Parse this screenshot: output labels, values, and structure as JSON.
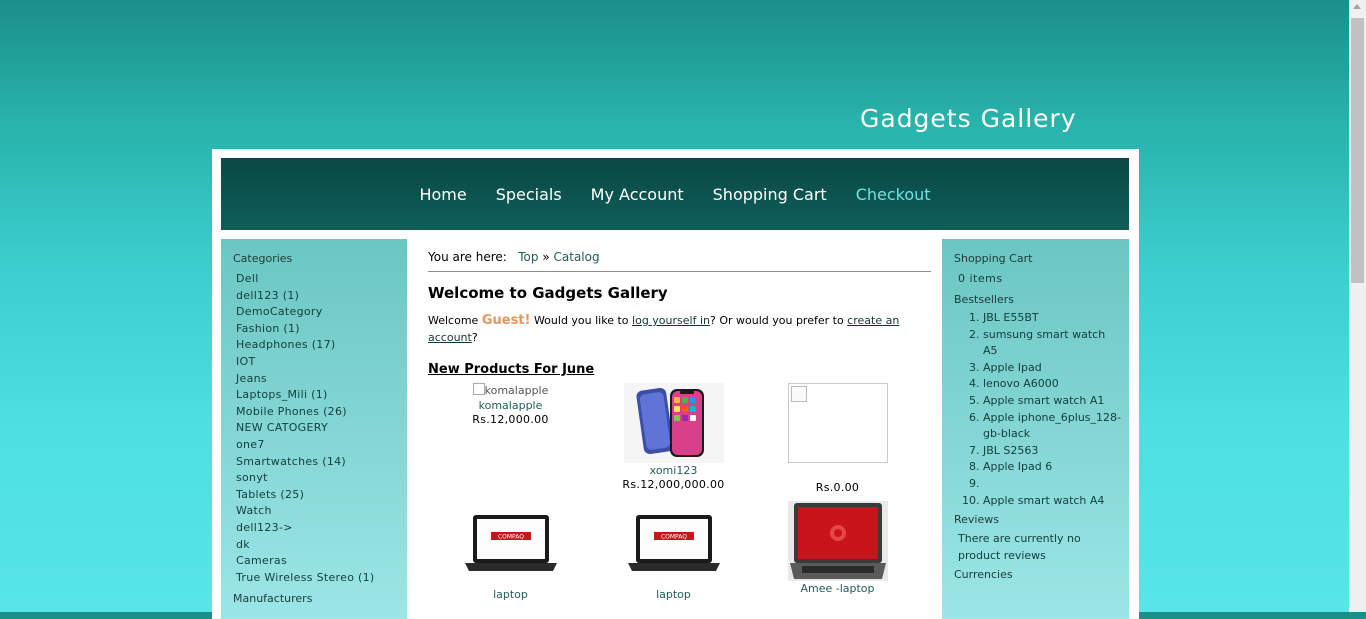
{
  "site": {
    "title": "Gadgets Gallery"
  },
  "nav": {
    "items": [
      {
        "label": "Home"
      },
      {
        "label": "Specials"
      },
      {
        "label": "My Account"
      },
      {
        "label": "Shopping Cart"
      },
      {
        "label": "Checkout"
      }
    ]
  },
  "left": {
    "categories_title": "Categories",
    "categories": [
      "Dell",
      "dell123 (1)",
      "DemoCategory",
      "Fashion (1)",
      "Headphones (17)",
      "IOT",
      "Jeans",
      "Laptops_Mili (1)",
      "Mobile Phones (26)",
      "NEW CATOGERY",
      "one7",
      "Smartwatches (14)",
      "sonyt",
      "Tablets (25)",
      "Watch",
      "dell123->",
      "dk",
      "Cameras",
      "True Wireless Stereo (1)"
    ],
    "manufacturers_title": "Manufacturers"
  },
  "content": {
    "breadcrumb_prefix": "You are here:",
    "breadcrumb_top": "Top",
    "breadcrumb_sep": "»",
    "breadcrumb_catalog": "Catalog",
    "heading": "Welcome to Gadgets Gallery",
    "welcome_text_1": "Welcome",
    "guest": "Guest!",
    "welcome_text_2": "Would you like to",
    "login_link": "log yourself in",
    "welcome_text_3": "? Or would you prefer to",
    "create_link": "create an account",
    "welcome_text_4": "?",
    "new_products": "New Products For June",
    "products": [
      {
        "name": "komalapple",
        "alt": "komalapple",
        "price": "Rs.12,000.00"
      },
      {
        "name": "xomi123",
        "price": "Rs.12,000,000.00"
      },
      {
        "name": "",
        "price": "Rs.0.00"
      },
      {
        "name": "laptop"
      },
      {
        "name": "laptop"
      },
      {
        "name": "Amee -laptop"
      }
    ]
  },
  "right": {
    "cart_title": "Shopping Cart",
    "cart_items": "0 items",
    "bestsellers_title": "Bestsellers",
    "bestsellers": [
      "JBL E55BT",
      "sumsung smart watch A5",
      "Apple Ipad",
      "lenovo A6000",
      "Apple smart watch A1",
      "Apple iphone_6plus_128-gb-black",
      "JBL S2563",
      "Apple Ipad 6",
      "",
      "Apple smart watch A4"
    ],
    "reviews_title": "Reviews",
    "reviews_text": "There are currently no product reviews",
    "currencies_title": "Currencies"
  }
}
